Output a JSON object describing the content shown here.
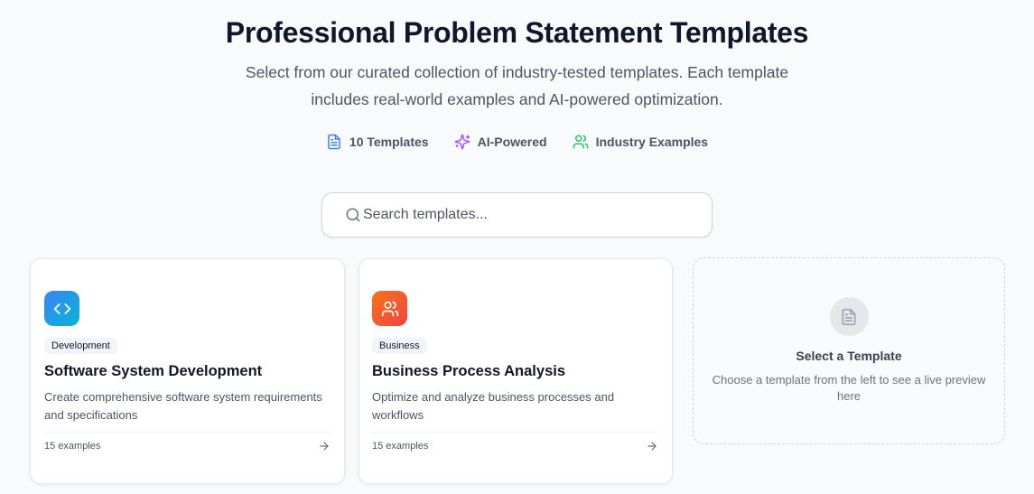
{
  "header": {
    "title": "Professional Problem Statement Templates",
    "subtitle": "Select from our curated collection of industry-tested templates. Each template includes real-world examples and AI-powered optimization."
  },
  "features": [
    {
      "label": "10 Templates",
      "icon": "document-icon",
      "color": "#3b82f6"
    },
    {
      "label": "AI-Powered",
      "icon": "sparkles-icon",
      "color": "#a855f7"
    },
    {
      "label": "Industry Examples",
      "icon": "users-icon",
      "color": "#22c55e"
    }
  ],
  "search": {
    "placeholder": "Search templates...",
    "value": ""
  },
  "templates": [
    {
      "icon": "code-icon",
      "category": "Development",
      "title": "Software System Development",
      "description": "Create comprehensive software system requirements and specifications",
      "examples": "15 examples",
      "accent": "#3b82f6"
    },
    {
      "icon": "users-icon",
      "category": "Business",
      "title": "Business Process Analysis",
      "description": "Optimize and analyze business processes and workflows",
      "examples": "15 examples",
      "accent": "#f97316"
    }
  ],
  "preview": {
    "icon": "document-icon",
    "title": "Select a Template",
    "description": "Choose a template from the left to see a live preview here"
  }
}
